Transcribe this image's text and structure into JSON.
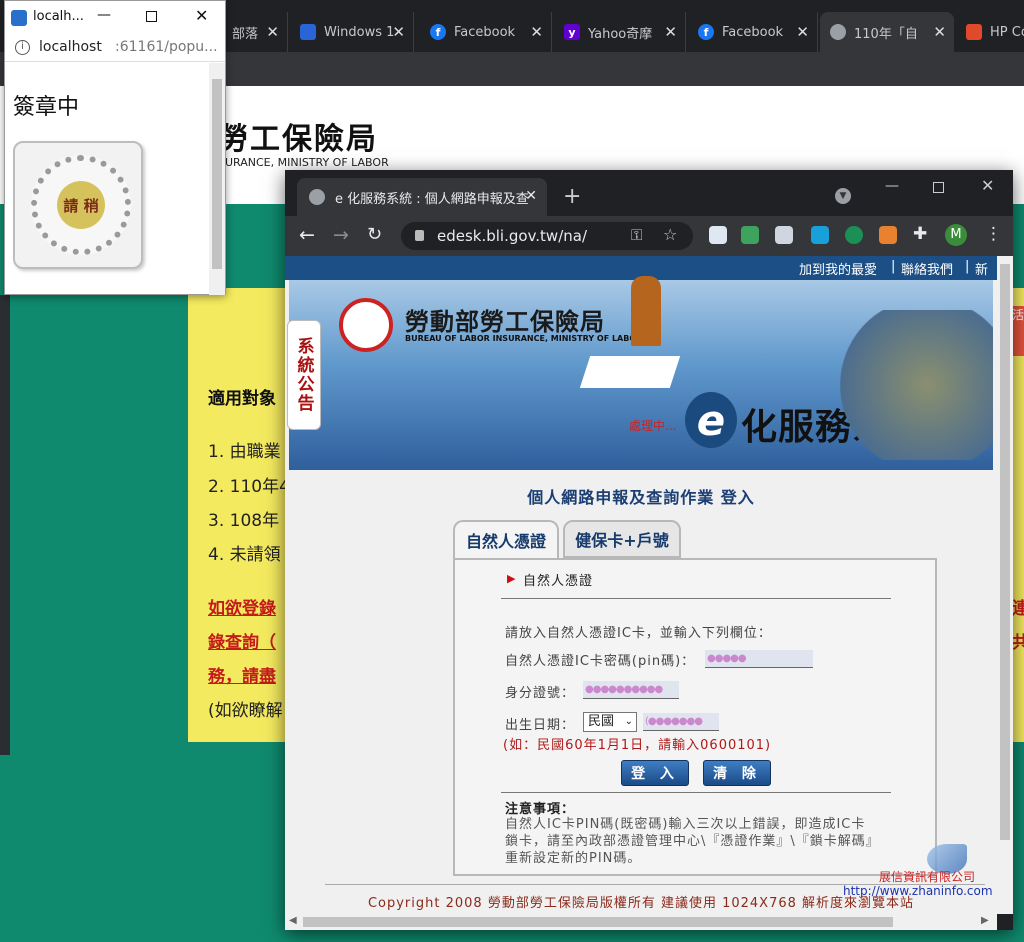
{
  "background_window": {
    "tabs": [
      {
        "label": "部落",
        "icon": "blank-icon"
      },
      {
        "label": "Windows 1",
        "icon": "windows-icon"
      },
      {
        "label": "Facebook",
        "icon": "facebook-icon"
      },
      {
        "label": "Yahoo奇摩",
        "icon": "yahoo-icon"
      },
      {
        "label": "Facebook",
        "icon": "facebook-icon"
      },
      {
        "label": "110年「自",
        "icon": "globe-icon"
      },
      {
        "label": "HP Co",
        "icon": "hp-icon"
      }
    ],
    "site_title": "勞工保險局",
    "site_subtitle": "SURANCE, MINISTRY OF LABOR",
    "content_heading": "適用對象",
    "list": [
      "1. 由職業",
      "2. 110年4",
      "3. 108年",
      "4. 未請領"
    ],
    "link_lines": [
      "如欲登錄",
      "錄查詢（",
      "務，請盡"
    ],
    "note_line": "(如欲瞭解",
    "right_fragments": [
      "活",
      "連",
      "共"
    ]
  },
  "popup": {
    "title": "localh...",
    "url_host": "localhost",
    "url_rest": ":61161/popu...",
    "heading": "簽章中",
    "stamp_label": "請 稍"
  },
  "fg_window": {
    "tab_title": "e 化服務系統 : 個人網路申報及查",
    "url": "edesk.bli.gov.tw/na/",
    "profile_initial": "M",
    "top_links": [
      "加到我的最愛",
      "聯絡我們",
      "新手"
    ],
    "banner": {
      "title": "勞動部勞工保險局",
      "title_en": "BUREAU OF LABOR INSURANCE, MINISTRY OF LABOR",
      "eservice": "化服務系統",
      "e_letter": "e",
      "processing": "處理中...",
      "notice": "系統公告"
    },
    "page_heading": "個人網路申報及查詢作業 登入",
    "tabs": [
      "自然人憑證",
      "健保卡+戶號"
    ],
    "section_title": "自然人憑證",
    "instruction": "請放入自然人憑證IC卡，並輸入下列欄位：",
    "fields": {
      "pin_label": "自然人憑證IC卡密碼(pin碼)：",
      "pin_value": "●●●●●",
      "id_label": "身分證號：",
      "id_value": "●●●●●●●●●●",
      "dob_label": "出生日期：",
      "era_value": "民國",
      "dob_value": "(●●●●●●●",
      "dob_hint": "(如：民國60年1月1日，請輸入0600101)"
    },
    "buttons": {
      "login": "登 入",
      "clear": "清 除"
    },
    "notes_title": "注意事項：",
    "notes_text": "自然人IC卡PIN碼(既密碼)輸入三次以上錯誤，即造成IC卡鎖卡，請至內政部憑證管理中心\\『憑證作業』\\『鎖卡解碼』重新設定新的PIN碼。",
    "copyright": "Copyright 2008 勞動部勞工保險局版權所有 建議使用 1024X768 解析度來瀏覽本站",
    "watermark_name": "展信資訊有限公司",
    "watermark_url": "http://www.zhaninfo.com"
  },
  "colors": {
    "accent_blue": "#1b4f86",
    "bg_green": "#0f8a6e",
    "yellow_panel": "#f4ea5f",
    "link_red": "#c41b1b"
  }
}
